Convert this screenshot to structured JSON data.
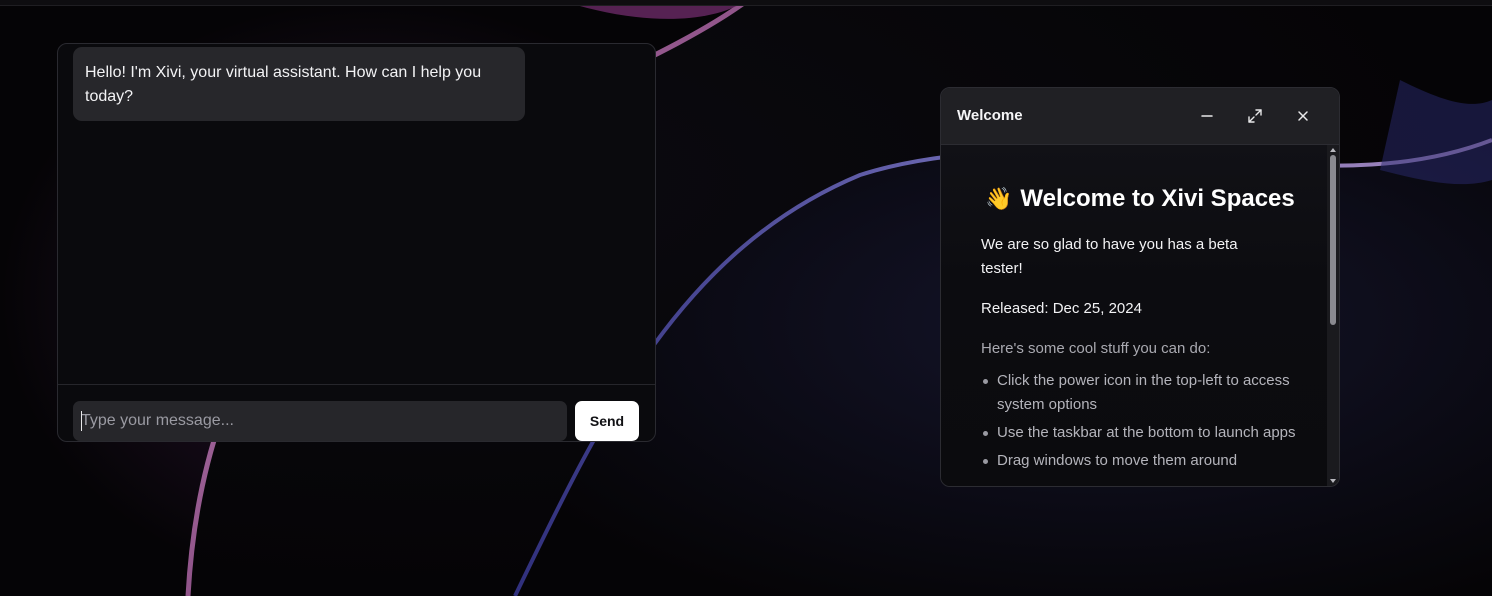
{
  "chat": {
    "greeting": "Hello! I'm Xivi, your virtual assistant. How can I help you today?",
    "input_placeholder": "Type your message...",
    "input_value": "",
    "send_label": "Send"
  },
  "welcome_window": {
    "title": "Welcome",
    "heading_emoji": "👋",
    "heading": "Welcome to Xivi Spaces",
    "glad_text": "We are so glad to have you has a beta tester!",
    "released_text": "Released: Dec 25, 2024",
    "cool_stuff_text": "Here's some cool stuff you can do:",
    "features": [
      "Click the power icon in the top-left to access system options",
      "Use the taskbar at the bottom to launch apps",
      "Drag windows to move them around"
    ],
    "controls": {
      "minimize_icon": "minimize-icon",
      "maximize_icon": "maximize-icon",
      "close_icon": "close-icon"
    }
  },
  "colors": {
    "chat_background": "#0a0a0d",
    "bubble_background": "#27272b",
    "send_button": "#ffffff",
    "titlebar": "#202024",
    "wallpaper_accent_pink": "#c46cb8",
    "wallpaper_accent_blue": "#5a5ad0"
  }
}
